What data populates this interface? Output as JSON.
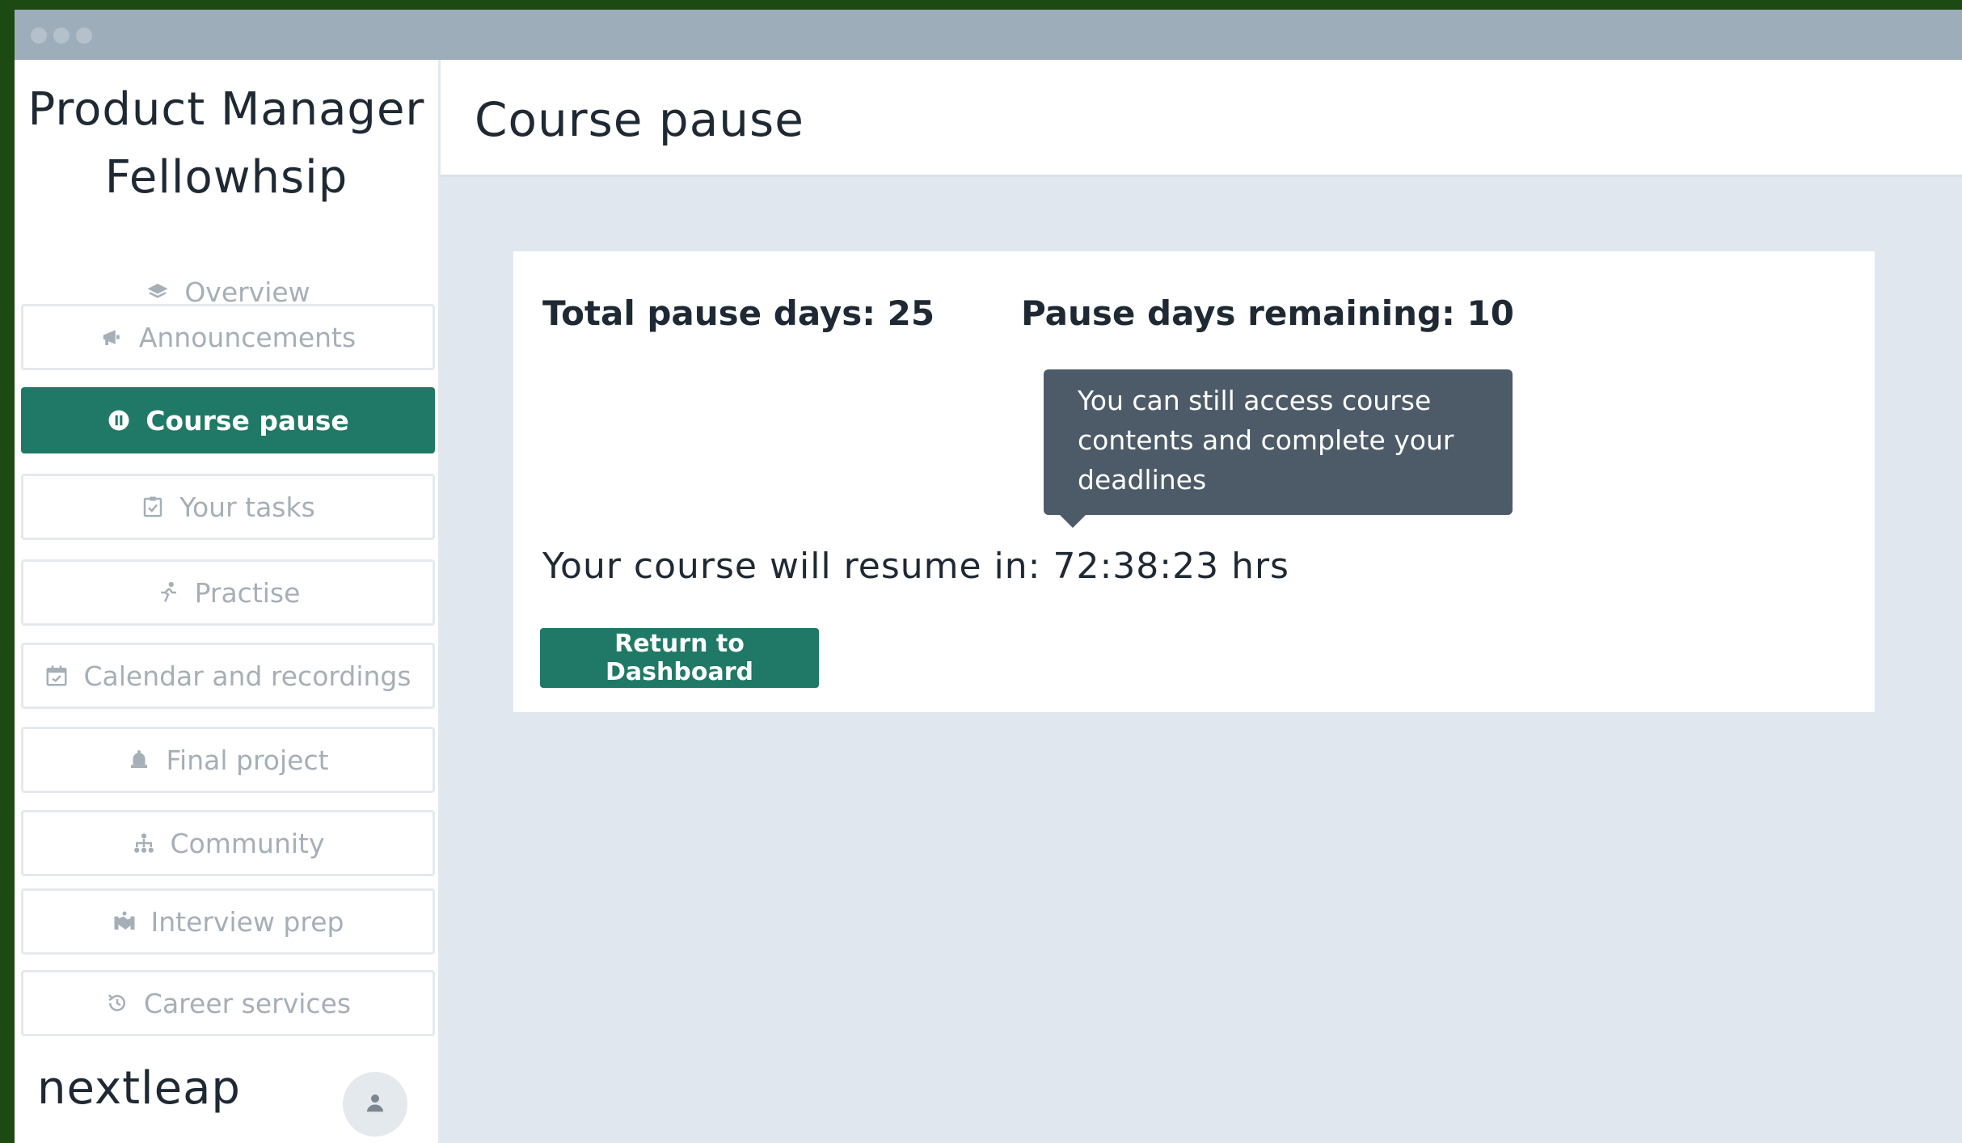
{
  "sidebar": {
    "title_line1": "Product Manager",
    "title_line2": "Fellowhsip",
    "items": [
      {
        "label": "Overview",
        "icon": "layers-icon"
      },
      {
        "label": "Announcements",
        "icon": "megaphone-icon"
      },
      {
        "label": "Course pause",
        "icon": "pause-icon",
        "active": true
      },
      {
        "label": "Your tasks",
        "icon": "clipboard-icon"
      },
      {
        "label": "Practise",
        "icon": "runner-icon"
      },
      {
        "label": "Calendar and recordings",
        "icon": "calendar-icon"
      },
      {
        "label": "Final project",
        "icon": "bell-icon"
      },
      {
        "label": "Community",
        "icon": "org-chart-icon"
      },
      {
        "label": "Interview prep",
        "icon": "handshake-icon"
      },
      {
        "label": "Career services",
        "icon": "clock-history-icon"
      }
    ],
    "logo": "nextleap",
    "avatar_icon": "user-icon"
  },
  "header": {
    "title": "Course pause"
  },
  "card": {
    "total_pause": "Total pause days: 25",
    "remaining_pause": "Pause days remaining: 10",
    "tooltip": "You can still access  course\ncontents and complete your\ndeadlines",
    "resume": "Your course will resume in: 72:38:23 hrs",
    "button": "Return to Dashboard"
  },
  "colors": {
    "accent": "#207966",
    "tooltip_bg": "#4d5b68",
    "main_bg": "#e1e7ef",
    "titlebar": "#9eadba",
    "outer_bg": "#1d4a12"
  }
}
